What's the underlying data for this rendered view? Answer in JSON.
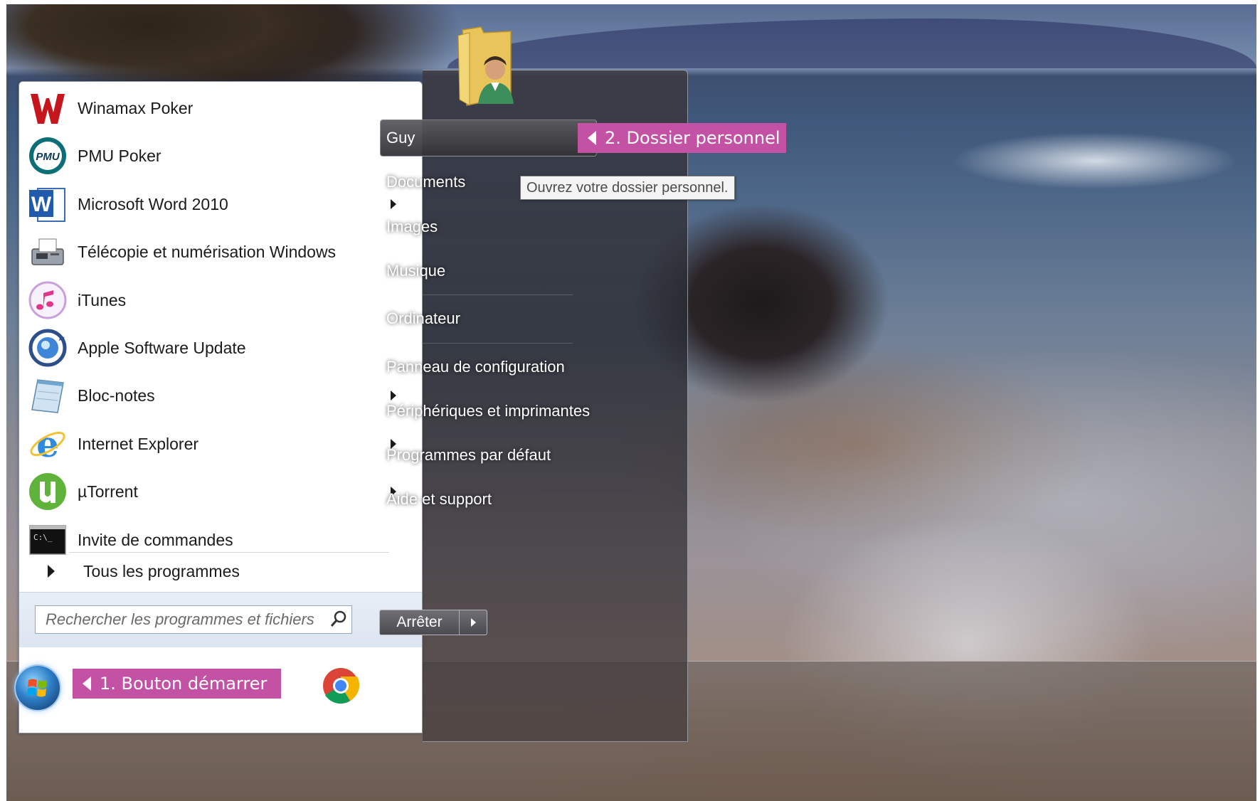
{
  "programs": [
    {
      "label": "Winamax Poker",
      "icon": "winamax-icon",
      "submenu": false
    },
    {
      "label": "PMU Poker",
      "icon": "pmu-icon",
      "submenu": false
    },
    {
      "label": "Microsoft Word 2010",
      "icon": "word-icon",
      "submenu": true
    },
    {
      "label": "Télécopie et numérisation Windows",
      "icon": "fax-icon",
      "submenu": false
    },
    {
      "label": "iTunes",
      "icon": "itunes-icon",
      "submenu": false
    },
    {
      "label": "Apple Software Update",
      "icon": "apple-update-icon",
      "submenu": false
    },
    {
      "label": "Bloc-notes",
      "icon": "notepad-icon",
      "submenu": true
    },
    {
      "label": "Internet Explorer",
      "icon": "ie-icon",
      "submenu": true
    },
    {
      "label": "µTorrent",
      "icon": "utorrent-icon",
      "submenu": true
    },
    {
      "label": "Invite de commandes",
      "icon": "cmd-icon",
      "submenu": false
    }
  ],
  "all_programs": "Tous les programmes",
  "search": {
    "placeholder": "Rechercher les programmes et fichiers"
  },
  "right": {
    "user": "Guy",
    "links": [
      "Documents",
      "Images",
      "Musique",
      "Ordinateur",
      "Panneau de configuration",
      "Périphériques et imprimantes",
      "Programmes par défaut",
      "Aide et support"
    ]
  },
  "shutdown": {
    "label": "Arrêter"
  },
  "tooltip": "Ouvrez votre dossier personnel.",
  "callouts": {
    "home_folder": "2. Dossier personnel",
    "start_button": "1. Bouton démarrer"
  },
  "colors": {
    "callout": "#c452a4"
  }
}
